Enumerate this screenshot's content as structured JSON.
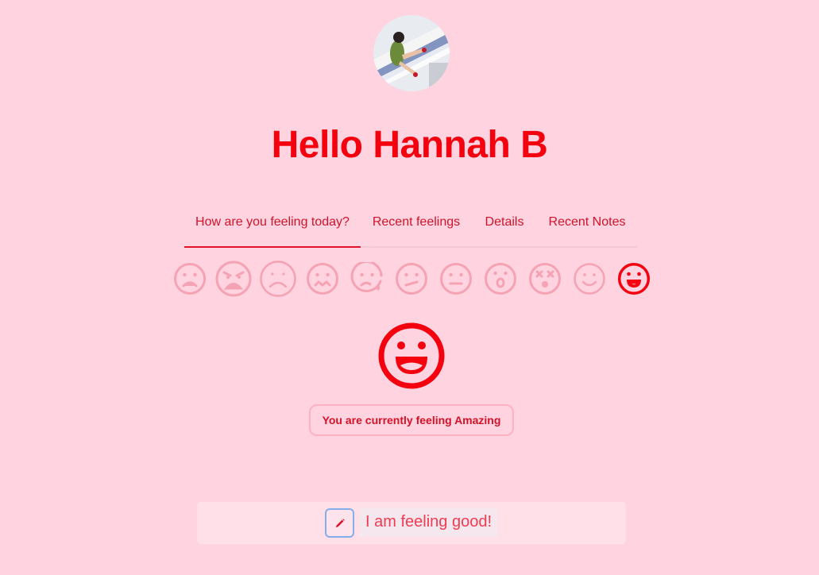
{
  "user": {
    "greeting": "Hello Hannah B",
    "avatar_icon": "avatar-photo"
  },
  "tabs": [
    {
      "label": "How are you feeling today?",
      "active": true
    },
    {
      "label": "Recent feelings",
      "active": false
    },
    {
      "label": "Details",
      "active": false
    },
    {
      "label": "Recent Notes",
      "active": false
    }
  ],
  "moods": [
    {
      "icon": "sad-face-icon",
      "selected": false
    },
    {
      "icon": "angry-face-icon",
      "selected": false
    },
    {
      "icon": "frown-face-icon",
      "selected": false
    },
    {
      "icon": "wavy-mouth-face-icon",
      "selected": false
    },
    {
      "icon": "crying-face-icon",
      "selected": false
    },
    {
      "icon": "confused-face-icon",
      "selected": false
    },
    {
      "icon": "neutral-face-icon",
      "selected": false
    },
    {
      "icon": "surprised-face-icon",
      "selected": false
    },
    {
      "icon": "dizzy-face-icon",
      "selected": false
    },
    {
      "icon": "smile-face-icon",
      "selected": false
    },
    {
      "icon": "grin-face-icon",
      "selected": true
    }
  ],
  "current": {
    "icon": "grin-face-icon",
    "status_text": "You are currently feeling Amazing"
  },
  "note": {
    "edit_icon": "pencil-icon",
    "text": "I am feeling good!"
  },
  "colors": {
    "background": "#ffd3df",
    "accent": "#f4000f",
    "muted_icon": "#f5a3b4"
  }
}
